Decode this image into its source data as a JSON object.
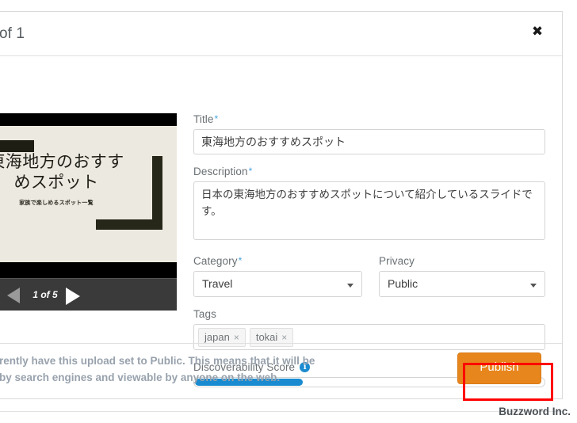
{
  "dialog": {
    "title": "of 1",
    "close_icon": "close-icon",
    "preview": {
      "slide_title": "東海地方のおすす\nめスポット",
      "slide_subtitle": "家族で楽しめるスポット一覧",
      "nav_counter": "1 of 5",
      "prev_icon": "triangle-left-icon",
      "next_icon": "triangle-right-icon"
    },
    "form": {
      "title_label": "Title",
      "title_required": "*",
      "title_value": "東海地方のおすすめスポット",
      "description_label": "Description",
      "description_required": "*",
      "description_value": "日本の東海地方のおすすめスポットについて紹介しているスライドです。",
      "category_label": "Category",
      "category_required": "*",
      "category_value": "Travel",
      "privacy_label": "Privacy",
      "privacy_value": "Public",
      "tags_label": "Tags",
      "tags": [
        {
          "label": "japan",
          "remove_icon": "×"
        },
        {
          "label": "tokai",
          "remove_icon": "×"
        }
      ],
      "score_label": "Discoverability Score",
      "score_info_icon": "i",
      "score_percent": 31
    },
    "footer": {
      "note_line1": "rently have this upload set to Public. This means that it will be",
      "note_line2": "by search engines and viewable by anyone on the web.",
      "publish_label": "Publish"
    }
  },
  "page": {
    "brand": "Buzzword Inc."
  },
  "colors": {
    "accent_orange": "#e8861e",
    "progress_blue": "#1a8bd0",
    "annotation_red": "#ff0000",
    "required_blue": "#4aa3df"
  }
}
